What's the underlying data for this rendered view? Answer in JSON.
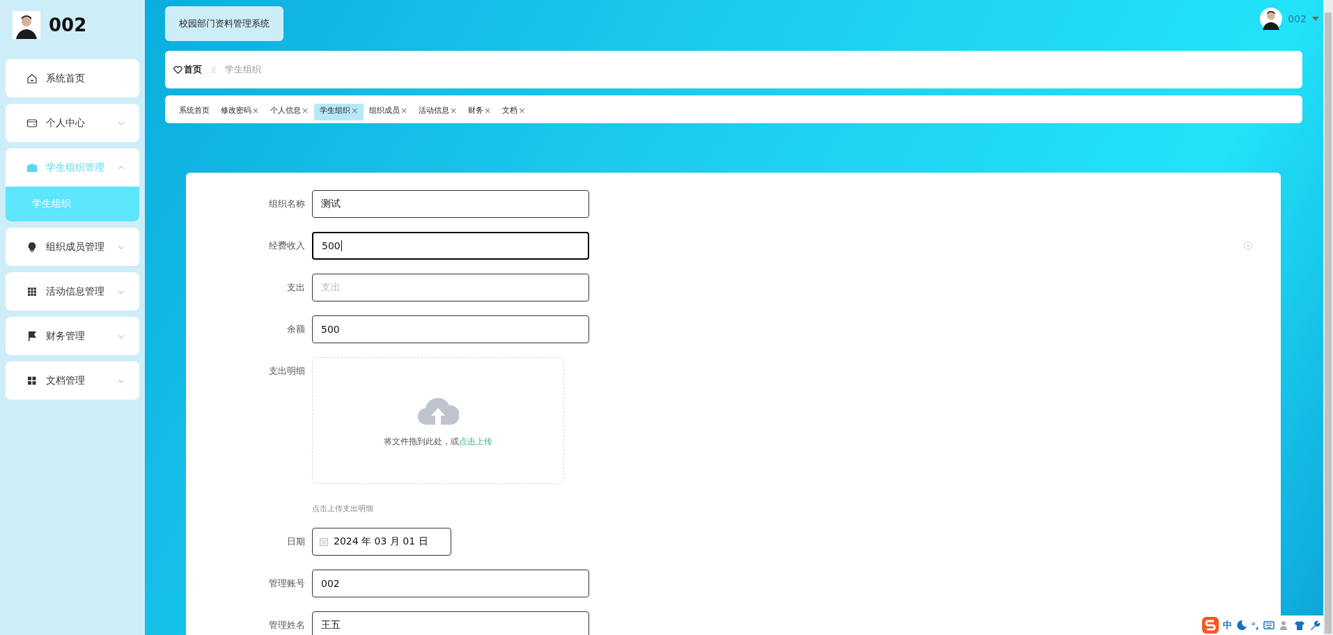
{
  "sidebar": {
    "user": {
      "name": "002"
    },
    "items": [
      {
        "label": "系统首页",
        "kind": "link"
      },
      {
        "label": "个人中心",
        "kind": "menu",
        "expanded": false
      },
      {
        "label": "学生组织管理",
        "kind": "menu",
        "expanded": true,
        "children": [
          {
            "label": "学生组织",
            "selected": true
          }
        ]
      },
      {
        "label": "组织成员管理",
        "kind": "menu",
        "expanded": false
      },
      {
        "label": "活动信息管理",
        "kind": "menu",
        "expanded": false
      },
      {
        "label": "财务管理",
        "kind": "menu",
        "expanded": false
      },
      {
        "label": "文档管理",
        "kind": "menu",
        "expanded": false
      }
    ]
  },
  "header": {
    "title": "校园部门资料管理系统",
    "user": "002"
  },
  "breadcrumb": {
    "home": "首页",
    "current": "学生组织"
  },
  "tabs": [
    {
      "label": "系统首页",
      "selected": false
    },
    {
      "label": "修改密码",
      "selected": false,
      "close": "×"
    },
    {
      "label": "个人信息",
      "selected": false,
      "close": "×"
    },
    {
      "label": "学生组织",
      "selected": true,
      "close": "×"
    },
    {
      "label": "组织成员",
      "selected": false,
      "close": "×"
    },
    {
      "label": "活动信息",
      "selected": false,
      "close": "×"
    },
    {
      "label": "财务",
      "selected": false,
      "close": "×"
    },
    {
      "label": "文档",
      "selected": false,
      "close": "×"
    }
  ],
  "form": {
    "fields": [
      {
        "kind": "input",
        "label": "组织名称",
        "value": "测试",
        "focused": false
      },
      {
        "kind": "input",
        "label": "经费收入",
        "value": "500",
        "focused": true
      },
      {
        "kind": "input",
        "label": "支出",
        "placeholder": "支出",
        "focused": false
      },
      {
        "kind": "input",
        "label": "余额",
        "value": "500",
        "focused": false
      },
      {
        "kind": "upload",
        "label": "支出明细",
        "text": "将文件拖到此处，或",
        "link": "点击上传",
        "hint": "点击上传支出明细"
      },
      {
        "kind": "date",
        "label": "日期",
        "value": "2024 年 03 月 01 日"
      },
      {
        "kind": "input",
        "label": "管理账号",
        "value": "002",
        "focused": false
      },
      {
        "kind": "input",
        "label": "管理姓名",
        "value": "王五",
        "focused": false
      }
    ]
  },
  "ime": {
    "mode": "中",
    "punct": "°,"
  }
}
